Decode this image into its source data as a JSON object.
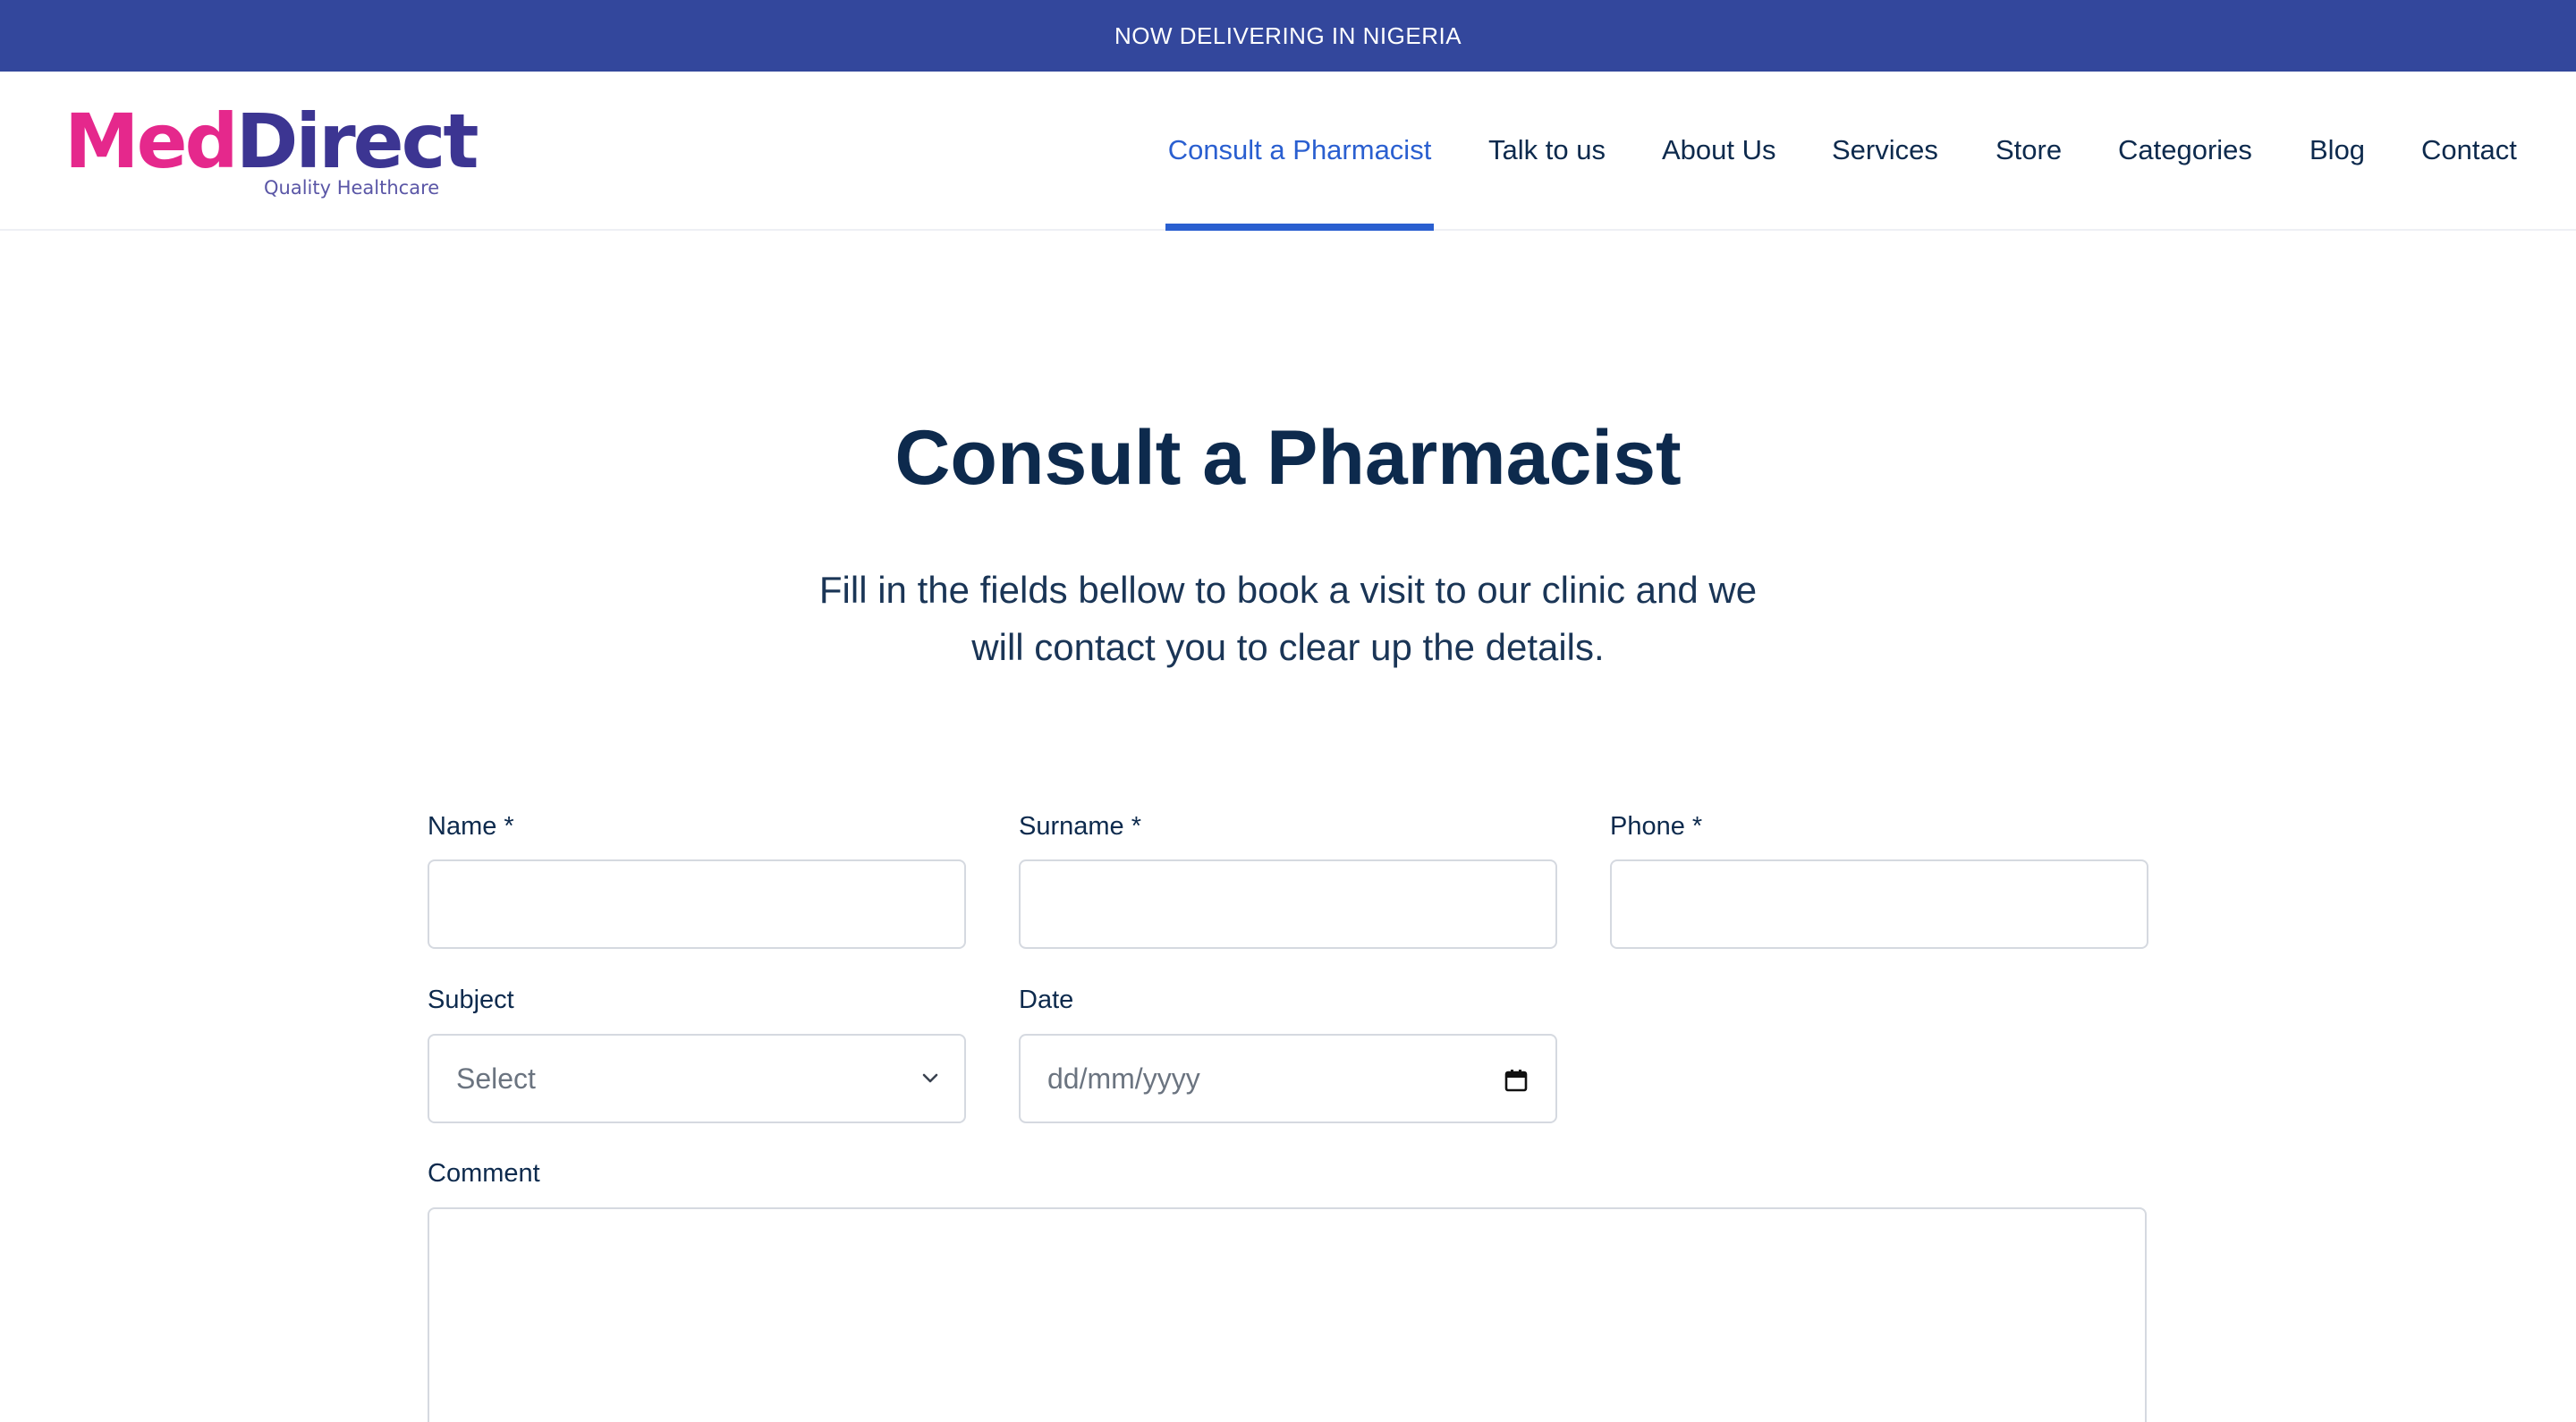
{
  "announcement": {
    "text": "NOW DELIVERING IN NIGERIA"
  },
  "brand": {
    "name_part1": "Med",
    "name_part2": "Direct",
    "tagline": "Quality Healthcare",
    "color_primary": "#e5288c",
    "color_secondary": "#3c3592"
  },
  "nav": {
    "items": [
      {
        "label": "Consult a Pharmacist",
        "active": true
      },
      {
        "label": "Talk to us"
      },
      {
        "label": "About Us"
      },
      {
        "label": "Services"
      },
      {
        "label": "Store"
      },
      {
        "label": "Categories"
      },
      {
        "label": "Blog"
      },
      {
        "label": "Contact"
      }
    ]
  },
  "page": {
    "title": "Consult a Pharmacist",
    "intro_line1": "Fill in the fields bellow to book a visit to our clinic and we",
    "intro_line2": "will contact you to clear up the details."
  },
  "form": {
    "name": {
      "label": "Name *",
      "value": ""
    },
    "surname": {
      "label": "Surname *",
      "value": ""
    },
    "phone": {
      "label": "Phone *",
      "value": ""
    },
    "subject": {
      "label": "Subject",
      "selected": "Select"
    },
    "date": {
      "label": "Date",
      "placeholder": "dd/mm/yyyy"
    },
    "comment": {
      "label": "Comment",
      "value": ""
    }
  },
  "colors": {
    "announce_bg": "#33479c",
    "accent": "#2a5fd0",
    "text": "#0d2a4d"
  }
}
